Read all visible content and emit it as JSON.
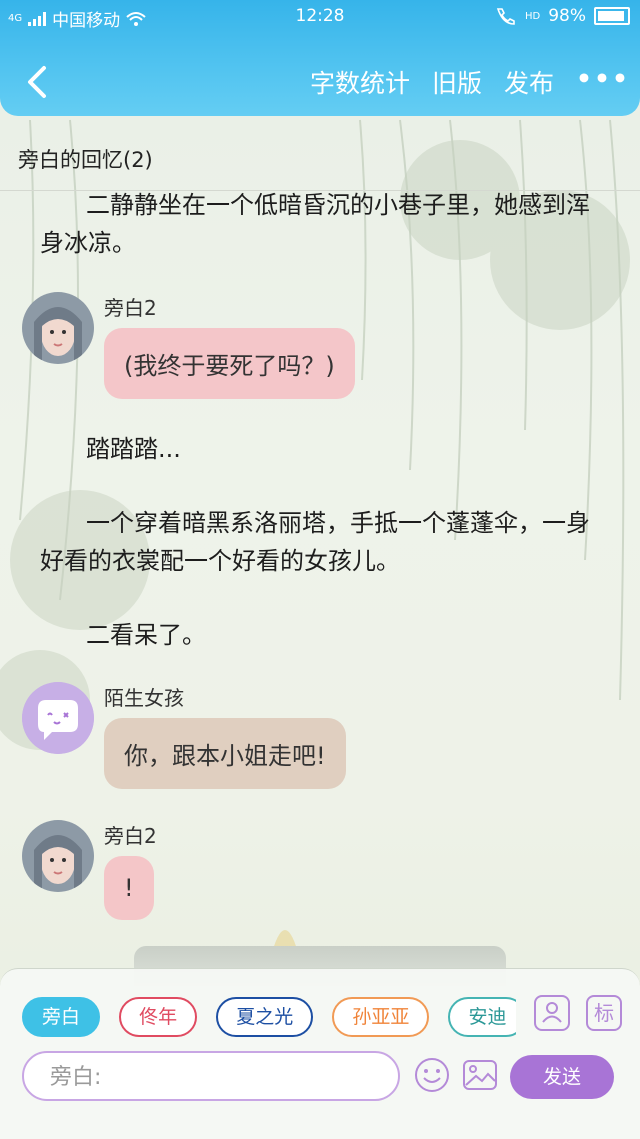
{
  "status_bar": {
    "network": "4G",
    "carrier": "中国移动",
    "time": "12:28",
    "hd_label": "HD",
    "battery": "98%"
  },
  "nav": {
    "back_icon": "chevron-left-icon",
    "word_count": "字数统计",
    "old_version": "旧版",
    "publish": "发布",
    "more": "•••"
  },
  "chapter": {
    "title": "旁白的回忆(2)"
  },
  "story": [
    {
      "type": "narration",
      "text": "二静静坐在一个低暗昏沉的小巷子里，她感到浑身冰凉。"
    },
    {
      "type": "message",
      "speaker": "旁白2",
      "text": "(我终于要死了吗？)",
      "bubble_color": "#f4c2c5"
    },
    {
      "type": "narration",
      "text": "踏踏踏..."
    },
    {
      "type": "narration",
      "text": "一个穿着暗黑系洛丽塔，手抵一个蓬蓬伞，一身好看的衣裳配一个好看的女孩儿。"
    },
    {
      "type": "narration",
      "text": "二看呆了。"
    },
    {
      "type": "message",
      "speaker": "陌生女孩",
      "text": "你，跟本小姐走吧!",
      "bubble_color": "#decbbe"
    },
    {
      "type": "message",
      "speaker": "旁白2",
      "text": "!",
      "bubble_color": "#f4c2c5"
    }
  ],
  "characters": [
    {
      "label": "旁白",
      "active": true,
      "color": "#3ec1e6"
    },
    {
      "label": "佟年",
      "active": false,
      "color": "#e04b61"
    },
    {
      "label": "夏之光",
      "active": false,
      "color": "#1d4fa3"
    },
    {
      "label": "孙亚亚",
      "active": false,
      "color": "#f0843a"
    },
    {
      "label": "安迪",
      "active": false,
      "color": "#2b9897"
    }
  ],
  "toolbar": {
    "avatar_icon": "character-avatar-icon",
    "mark_label": "标"
  },
  "composer": {
    "placeholder": "旁白:",
    "emoji_icon": "emoji-icon",
    "image_icon": "image-icon",
    "send_label": "发送"
  },
  "colors": {
    "header": "#3db8ec",
    "accent_purple": "#a874d6",
    "pink_bubble": "#f4c2c5",
    "tan_bubble": "#decbbe"
  }
}
